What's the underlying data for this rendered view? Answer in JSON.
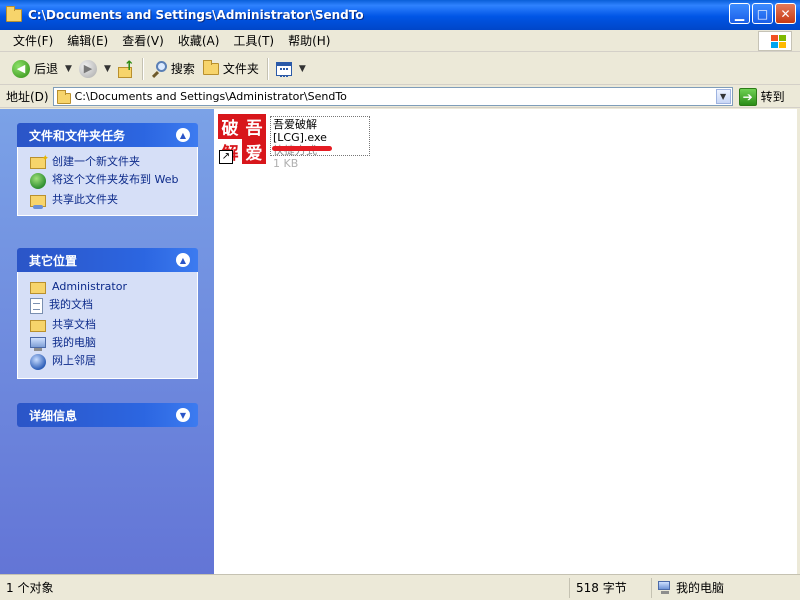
{
  "window": {
    "title": "C:\\Documents and Settings\\Administrator\\SendTo",
    "buttons": {
      "minimize": "▁",
      "maximize": "□",
      "close": "✕"
    }
  },
  "menu": [
    "文件(F)",
    "编辑(E)",
    "查看(V)",
    "收藏(A)",
    "工具(T)",
    "帮助(H)"
  ],
  "toolbar": {
    "back_label": "后退",
    "search_label": "搜索",
    "folders_label": "文件夹"
  },
  "address": {
    "label": "地址(D)",
    "value": "C:\\Documents and Settings\\Administrator\\SendTo",
    "go_label": "转到"
  },
  "tasks_panel": {
    "title": "文件和文件夹任务",
    "items": [
      "创建一个新文件夹",
      "将这个文件夹发布到 Web",
      "共享此文件夹"
    ]
  },
  "places_panel": {
    "title": "其它位置",
    "items": [
      "Administrator",
      "我的文档",
      "共享文档",
      "我的电脑",
      "网上邻居"
    ]
  },
  "details_panel": {
    "title": "详细信息"
  },
  "file": {
    "name": "吾爱破解[LCG].exe",
    "type": "快捷方式",
    "size": "1 KB",
    "icon_chars": [
      "破",
      "吾",
      "解",
      "爱"
    ]
  },
  "status": {
    "objects": "1 个对象",
    "size": "518 字节",
    "location": "我的电脑"
  },
  "colors": {
    "titlebar": "#0055e5",
    "taskpane": "#6f8ce0",
    "panel_header": "#2c66e1",
    "accent_red": "#d8161b"
  }
}
